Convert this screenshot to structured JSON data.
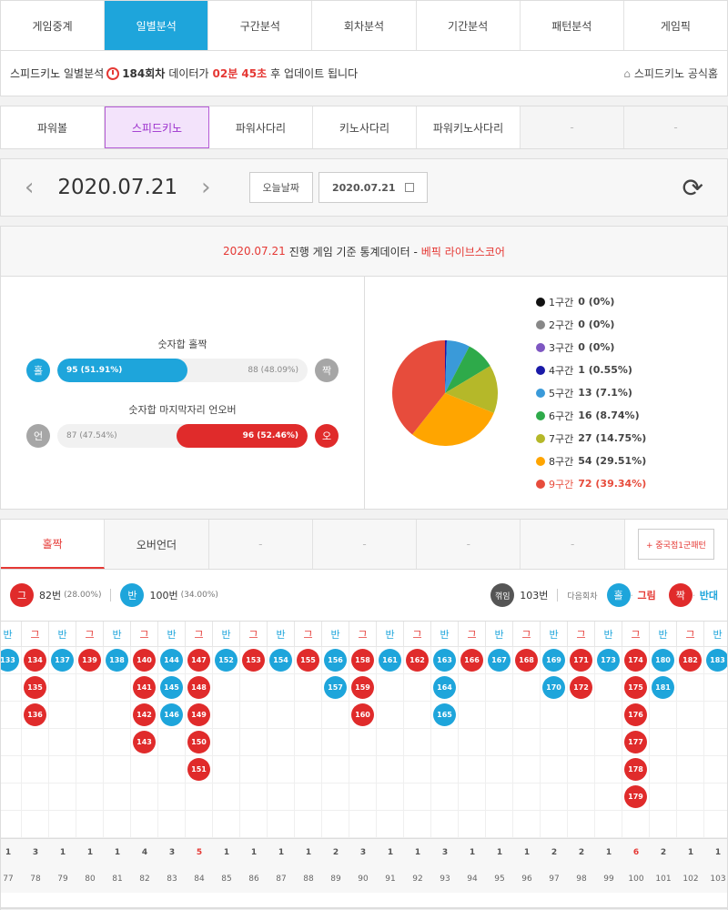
{
  "top_tabs": [
    "게임중계",
    "일별분석",
    "구간분석",
    "회차분석",
    "기간분석",
    "패턴분석",
    "게임픽"
  ],
  "active_tab": 1,
  "info": {
    "prefix": "스피드키노 일별분석",
    "round": "184회차",
    "mid": "데이터가",
    "time": "02분 45초",
    "suffix": "후 업데이트 됩니다",
    "link": "스피드키노 공식홈"
  },
  "sub_tabs": [
    "파워볼",
    "스피드키노",
    "파워사다리",
    "키노사다리",
    "파워키노사다리",
    "-",
    "-"
  ],
  "active_sub": 1,
  "date_nav": {
    "date": "2020.07.21",
    "today_label": "오늘날짜",
    "picker_value": "2020.07.21"
  },
  "stat_header": {
    "date": "2020.07.21",
    "text": "진행 게임 기준 통계데이터 -",
    "source": "베픽 라이브스코어"
  },
  "stats": {
    "oddeven_label": "숫자합 홀짝",
    "odd_circle": "홀",
    "even_circle": "짝",
    "odd_value": "95 (51.91%)",
    "odd_fraction": 0.5191,
    "even_value": "88 (48.09%)",
    "underover_label": "숫자합 마지막자리 언오버",
    "under_circle": "언",
    "over_circle": "오",
    "under_value": "87 (47.54%)",
    "over_value": "96 (52.46%)",
    "over_fraction": 0.5246
  },
  "chart_data": {
    "type": "pie",
    "categories": [
      "1구간",
      "2구간",
      "3구간",
      "4구간",
      "5구간",
      "6구간",
      "7구간",
      "8구간",
      "9구간"
    ],
    "values": [
      0,
      0,
      0,
      1,
      13,
      16,
      27,
      54,
      72
    ],
    "labels": [
      "0 (0%)",
      "0 (0%)",
      "0 (0%)",
      "1 (0.55%)",
      "13 (7.1%)",
      "16 (8.74%)",
      "27 (14.75%)",
      "54 (29.51%)",
      "72 (39.34%)"
    ],
    "colors": [
      "#111111",
      "#888888",
      "#7e57c2",
      "#1a1aa8",
      "#3a9ad9",
      "#2eaa4a",
      "#b5b829",
      "#ffa500",
      "#e74c3c"
    ]
  },
  "lower_tabs": [
    "홀짝",
    "오버언더",
    "-",
    "-",
    "-",
    "-"
  ],
  "pattern_button": "+ 중국점1군패턴",
  "counts": {
    "g_circle": "그",
    "g_label": "82번",
    "g_pct": "(28.00%)",
    "b_circle": "반",
    "b_label": "100번",
    "b_pct": "(34.00%)",
    "k_circle": "꺾임",
    "k_label": "103번",
    "next_label": "다음회차",
    "odd_circle": "홀",
    "odd_result": "그림",
    "even_circle": "짝",
    "even_result": "반대"
  },
  "pattern_columns": [
    {
      "h": "반",
      "c": "b",
      "balls": [
        "133"
      ],
      "count": "1",
      "round": "77"
    },
    {
      "h": "그",
      "c": "r",
      "balls": [
        "134",
        "135",
        "136"
      ],
      "count": "3",
      "round": "78"
    },
    {
      "h": "반",
      "c": "b",
      "balls": [
        "137"
      ],
      "count": "1",
      "round": "79"
    },
    {
      "h": "그",
      "c": "r",
      "balls": [
        "139"
      ],
      "count": "1",
      "round": "80"
    },
    {
      "h": "반",
      "c": "b",
      "balls": [
        "138"
      ],
      "count": "1",
      "round": "81"
    },
    {
      "h": "그",
      "c": "r",
      "balls": [
        "140",
        "141",
        "142",
        "143"
      ],
      "count": "4",
      "round": "82"
    },
    {
      "h": "반",
      "c": "b",
      "balls": [
        "144",
        "145",
        "146"
      ],
      "count": "3",
      "round": "83"
    },
    {
      "h": "그",
      "c": "r",
      "balls": [
        "147",
        "148",
        "149",
        "150",
        "151"
      ],
      "count": "5",
      "round": "84",
      "hi": true
    },
    {
      "h": "반",
      "c": "b",
      "balls": [
        "152"
      ],
      "count": "1",
      "round": "85"
    },
    {
      "h": "그",
      "c": "r",
      "balls": [
        "153"
      ],
      "count": "1",
      "round": "86"
    },
    {
      "h": "반",
      "c": "b",
      "balls": [
        "154"
      ],
      "count": "1",
      "round": "87"
    },
    {
      "h": "그",
      "c": "r",
      "balls": [
        "155"
      ],
      "count": "1",
      "round": "88"
    },
    {
      "h": "반",
      "c": "b",
      "balls": [
        "156",
        "157"
      ],
      "count": "2",
      "round": "89"
    },
    {
      "h": "그",
      "c": "r",
      "balls": [
        "158",
        "159",
        "160"
      ],
      "count": "3",
      "round": "90"
    },
    {
      "h": "반",
      "c": "b",
      "balls": [
        "161"
      ],
      "count": "1",
      "round": "91"
    },
    {
      "h": "그",
      "c": "r",
      "balls": [
        "162"
      ],
      "count": "1",
      "round": "92"
    },
    {
      "h": "반",
      "c": "b",
      "balls": [
        "163",
        "164",
        "165"
      ],
      "count": "3",
      "round": "93"
    },
    {
      "h": "그",
      "c": "r",
      "balls": [
        "166"
      ],
      "count": "1",
      "round": "94"
    },
    {
      "h": "반",
      "c": "b",
      "balls": [
        "167"
      ],
      "count": "1",
      "round": "95"
    },
    {
      "h": "그",
      "c": "r",
      "balls": [
        "168"
      ],
      "count": "1",
      "round": "96"
    },
    {
      "h": "반",
      "c": "b",
      "balls": [
        "169",
        "170"
      ],
      "count": "2",
      "round": "97"
    },
    {
      "h": "그",
      "c": "r",
      "balls": [
        "171",
        "172"
      ],
      "count": "2",
      "round": "98"
    },
    {
      "h": "반",
      "c": "b",
      "balls": [
        "173"
      ],
      "count": "1",
      "round": "99"
    },
    {
      "h": "그",
      "c": "r",
      "balls": [
        "174",
        "175",
        "176",
        "177",
        "178",
        "179"
      ],
      "count": "6",
      "round": "100",
      "hi": true
    },
    {
      "h": "반",
      "c": "b",
      "balls": [
        "180",
        "181"
      ],
      "count": "2",
      "round": "101"
    },
    {
      "h": "그",
      "c": "r",
      "balls": [
        "182"
      ],
      "count": "1",
      "round": "102"
    },
    {
      "h": "반",
      "c": "b",
      "balls": [
        "183"
      ],
      "count": "1",
      "round": "103"
    }
  ]
}
